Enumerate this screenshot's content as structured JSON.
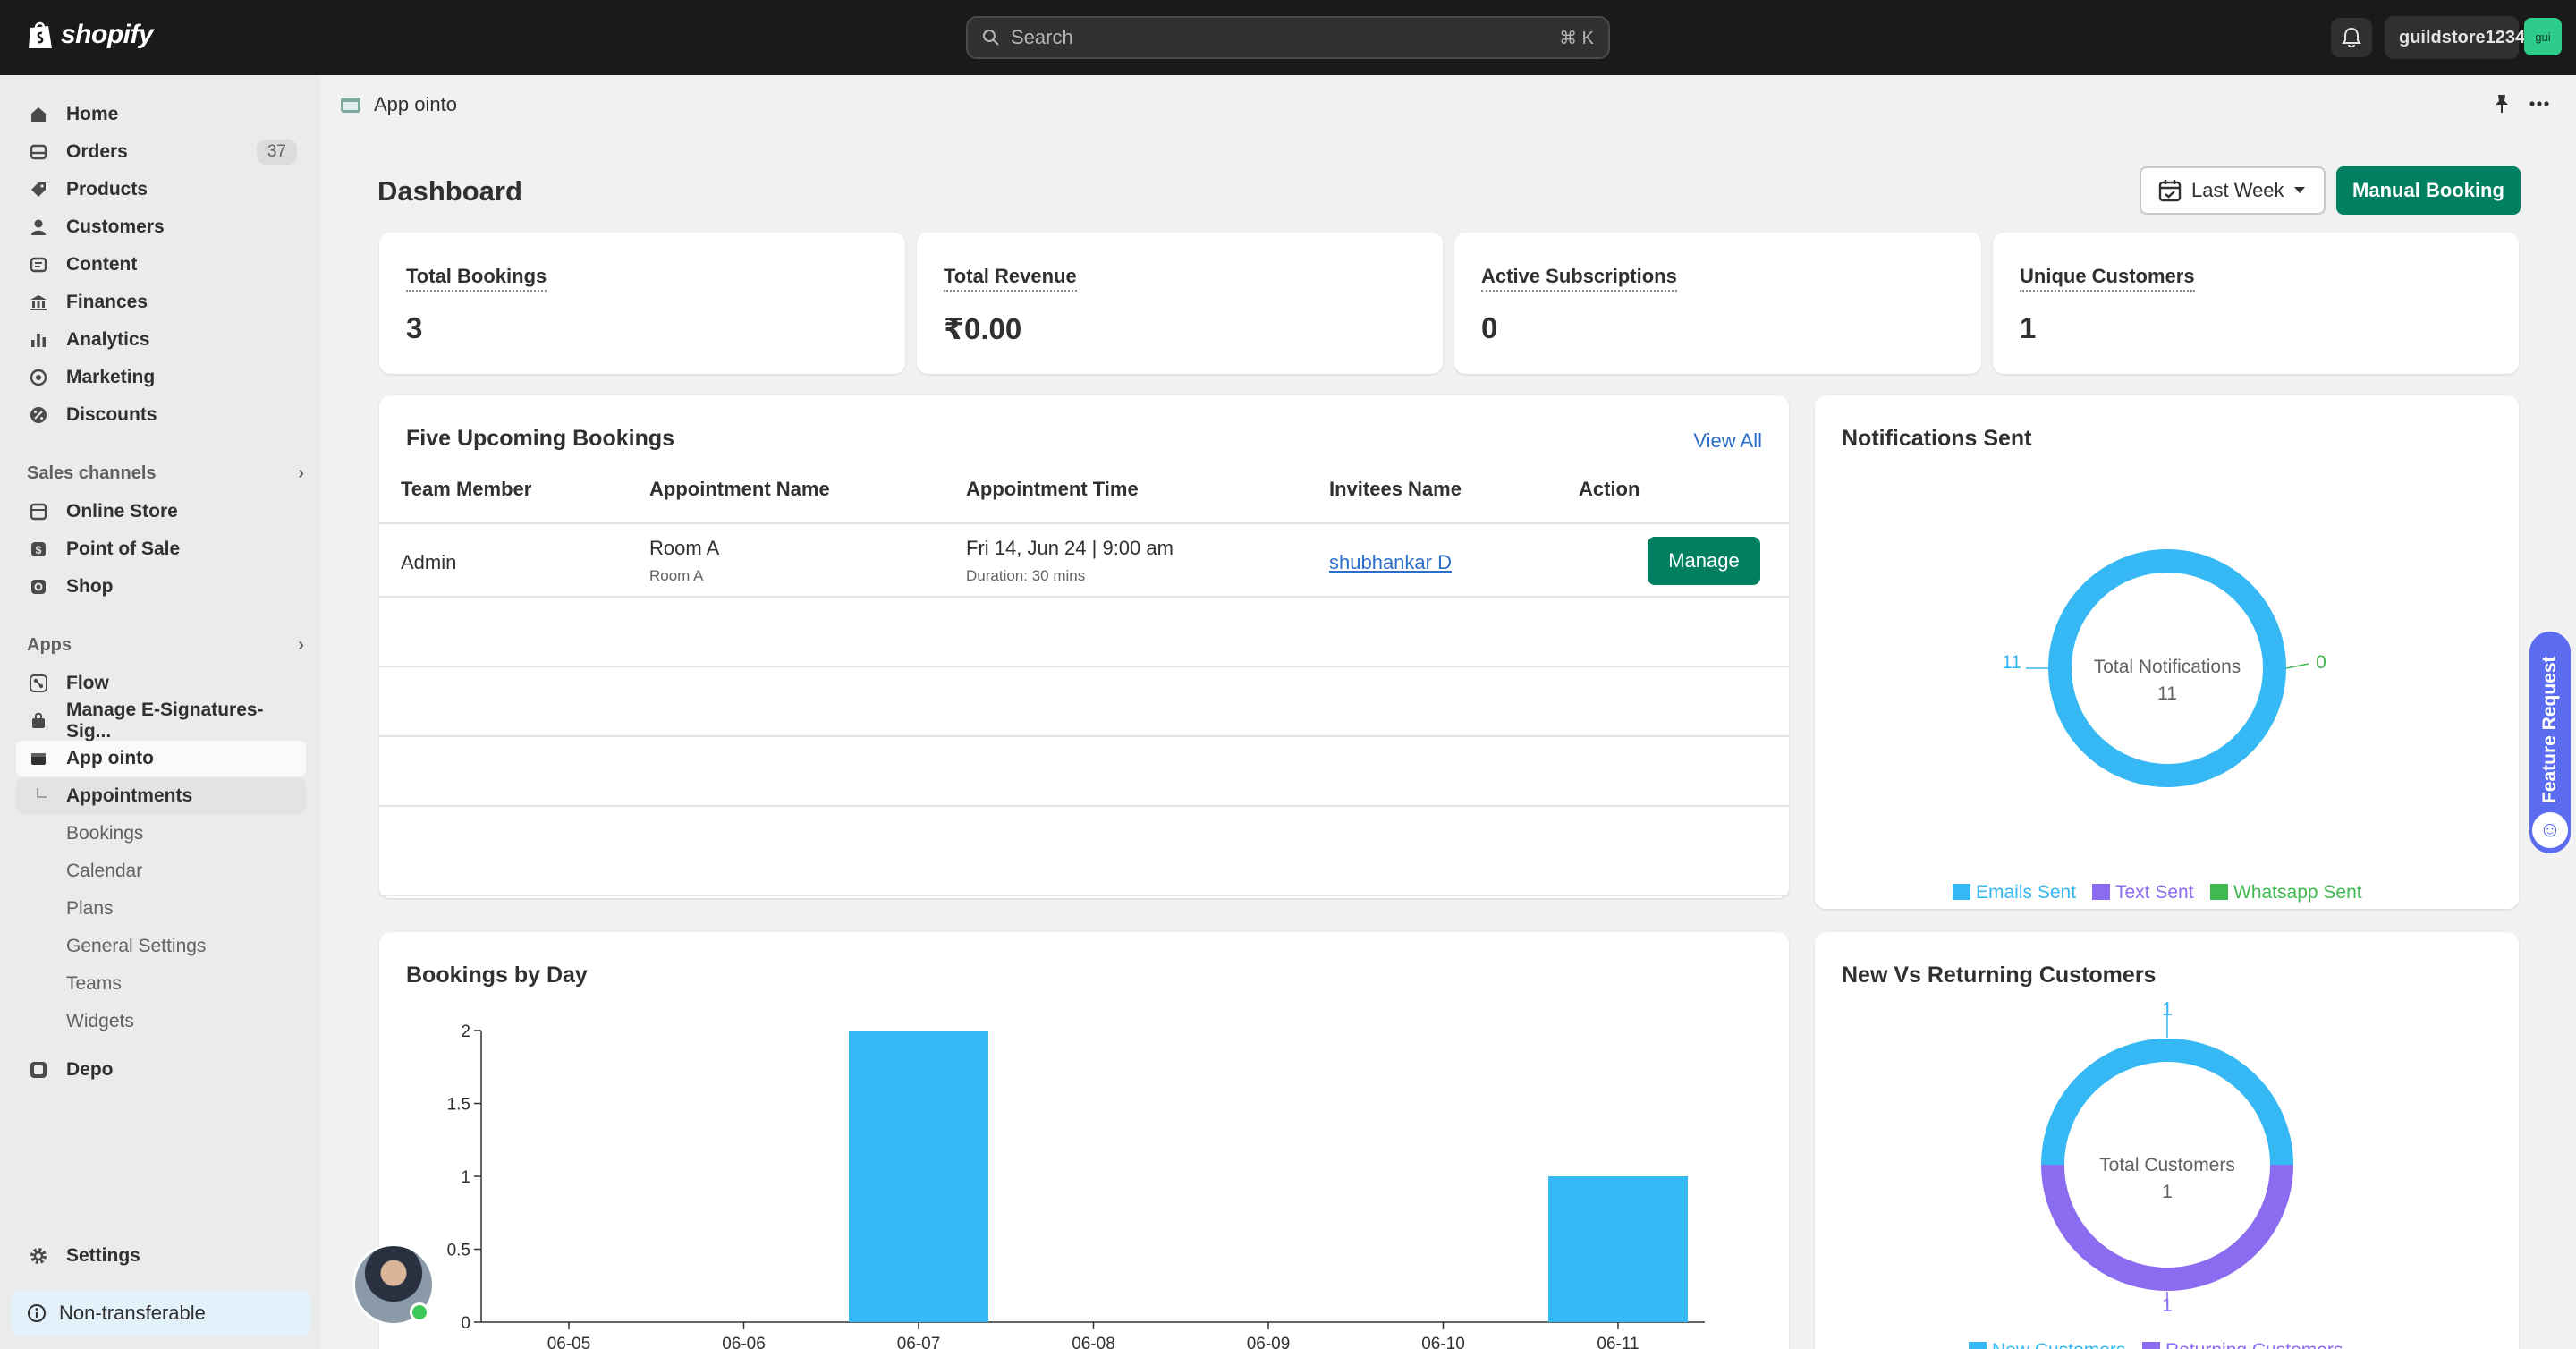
{
  "topbar": {
    "brand": "shopify",
    "search_placeholder": "Search",
    "search_shortcut": "⌘ K",
    "store_name": "guildstore1234",
    "store_avatar": "gui"
  },
  "sidebar": {
    "main_items": [
      {
        "label": "Home",
        "icon": "home-icon"
      },
      {
        "label": "Orders",
        "icon": "orders-icon",
        "badge": "37"
      },
      {
        "label": "Products",
        "icon": "tag-icon"
      },
      {
        "label": "Customers",
        "icon": "person-icon"
      },
      {
        "label": "Content",
        "icon": "content-icon"
      },
      {
        "label": "Finances",
        "icon": "bank-icon"
      },
      {
        "label": "Analytics",
        "icon": "analytics-icon"
      },
      {
        "label": "Marketing",
        "icon": "target-icon"
      },
      {
        "label": "Discounts",
        "icon": "discount-icon"
      }
    ],
    "sales_channels_label": "Sales channels",
    "sales_channels": [
      {
        "label": "Online Store",
        "icon": "store-icon"
      },
      {
        "label": "Point of Sale",
        "icon": "pos-icon"
      },
      {
        "label": "Shop",
        "icon": "shop-icon"
      }
    ],
    "apps_label": "Apps",
    "apps": [
      {
        "label": "Flow",
        "icon": "flow-icon"
      },
      {
        "label": "Manage E-Signatures-Sig...",
        "icon": "signature-icon"
      },
      {
        "label": "App ointo",
        "icon": "app-icon"
      }
    ],
    "app_sub_items": [
      "Appointments",
      "Bookings",
      "Calendar",
      "Plans",
      "General Settings",
      "Teams",
      "Widgets"
    ],
    "depo": "Depo",
    "settings": "Settings",
    "non_transferable": "Non-transferable"
  },
  "appbar": {
    "title": "App ointo"
  },
  "dashboard": {
    "title": "Dashboard",
    "range_label": "Last Week",
    "manual_booking": "Manual Booking",
    "stats": [
      {
        "label": "Total Bookings",
        "value": "3"
      },
      {
        "label": "Total Revenue",
        "value": "₹0.00"
      },
      {
        "label": "Active Subscriptions",
        "value": "0"
      },
      {
        "label": "Unique Customers",
        "value": "1"
      }
    ]
  },
  "upcoming": {
    "title": "Five Upcoming Bookings",
    "view_all": "View All",
    "columns": [
      "Team Member",
      "Appointment Name",
      "Appointment Time",
      "Invitees Name",
      "Action"
    ],
    "rows": [
      {
        "member": "Admin",
        "appointment": "Room A",
        "appointment_sub": "Room A",
        "time": "Fri 14, Jun 24 | 9:00 am",
        "duration": "Duration: 30 mins",
        "invitee": "shubhankar D",
        "action": "Manage"
      }
    ]
  },
  "notifications": {
    "title": "Notifications Sent",
    "center_label": "Total Notifications",
    "center_value": "11",
    "left_value": "11",
    "right_value": "0",
    "legend": [
      "Emails Sent",
      "Text Sent",
      "Whatsapp Sent"
    ],
    "colors": {
      "emails": "#35b8f3",
      "text": "#8b6cf0",
      "whatsapp": "#3fb950"
    }
  },
  "bookings_by_day": {
    "title": "Bookings by Day"
  },
  "customers": {
    "title": "New Vs Returning Customers",
    "center_label": "Total Customers",
    "center_value": "1",
    "top_value": "1",
    "bottom_value": "1",
    "legend": [
      "New Customers",
      "Returning Customers"
    ],
    "colors": {
      "new": "#35b8f3",
      "returning": "#8b6cf0"
    }
  },
  "feature_request": "Feature Request",
  "chart_data": [
    {
      "type": "bar",
      "title": "Bookings by Day",
      "categories": [
        "06-05",
        "06-06",
        "06-07",
        "06-08",
        "06-09",
        "06-10",
        "06-11"
      ],
      "values": [
        0,
        0,
        2,
        0,
        0,
        0,
        1
      ],
      "ylim": [
        0,
        2
      ],
      "yticks": [
        "0",
        "0.5",
        "1",
        "1.5",
        "2"
      ],
      "color": "#35b8f3"
    },
    {
      "type": "pie",
      "title": "Notifications Sent",
      "categories": [
        "Emails Sent",
        "Text Sent",
        "Whatsapp Sent"
      ],
      "values": [
        11,
        0,
        0
      ]
    },
    {
      "type": "pie",
      "title": "New Vs Returning Customers",
      "categories": [
        "New Customers",
        "Returning Customers"
      ],
      "values": [
        1,
        1
      ]
    }
  ]
}
